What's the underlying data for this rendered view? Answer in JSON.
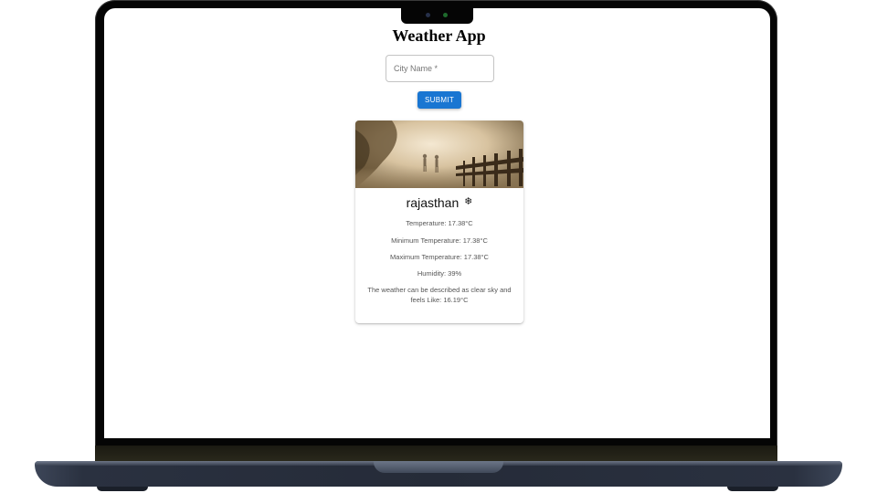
{
  "app": {
    "title": "Weather App"
  },
  "form": {
    "city_placeholder": "City Name *",
    "city_value": "",
    "submit_label": "SUBMIT"
  },
  "card": {
    "city": "rajasthan",
    "weather_icon": "snowflake-icon",
    "weather_icon_glyph": "❄",
    "temperature": "Temperature: 17.38°C",
    "min_temperature": "Minimum Temperature: 17.38°C",
    "max_temperature": "Maximum Temperature: 17.38°C",
    "humidity": "Humidity: 39%",
    "description": "The weather can be described as clear sky and feels Like: 16.19°C"
  },
  "colors": {
    "accent": "#1976d2",
    "text_muted": "#555555"
  }
}
